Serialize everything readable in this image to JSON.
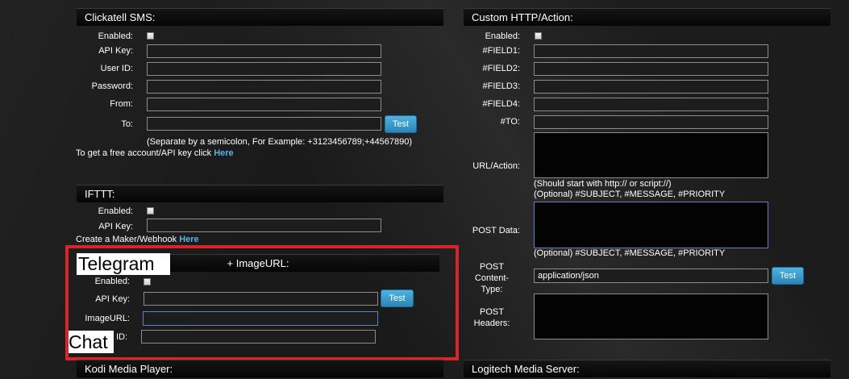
{
  "clickatell": {
    "title": "Clickatell SMS:",
    "enabled_label": "Enabled:",
    "api_key_label": "API Key:",
    "user_id_label": "User ID:",
    "password_label": "Password:",
    "from_label": "From:",
    "to_label": "To:",
    "test_label": "Test",
    "hint": "(Separate by a semicolon, For Example: +3123456789;+44567890)",
    "account_text": "To get a free account/API key click",
    "account_link": "Here"
  },
  "ifttt": {
    "title": "IFTTT:",
    "enabled_label": "Enabled:",
    "api_key_label": "API Key:",
    "maker_text": "Create a Maker/Webhook",
    "maker_link": "Here"
  },
  "telegram": {
    "title_suffix": "+ ImageURL:",
    "overlay_title": "Telegram",
    "enabled_label": "Enabled:",
    "api_key_label": "API Key:",
    "test_label": "Test",
    "image_url_label": "ImageURL:",
    "chat_id_label_suffix": "ID:",
    "overlay_chat": "Chat"
  },
  "kodi": {
    "title": "Kodi Media Player:"
  },
  "custom_http": {
    "title": "Custom HTTP/Action:",
    "enabled_label": "Enabled:",
    "field1_label": "#FIELD1:",
    "field2_label": "#FIELD2:",
    "field3_label": "#FIELD3:",
    "field4_label": "#FIELD4:",
    "to_label": "#TO:",
    "url_label": "URL/Action:",
    "url_hint1": "(Should start with http:// or script://)",
    "url_hint2": "(Optional) #SUBJECT, #MESSAGE, #PRIORITY",
    "post_data_label": "POST Data:",
    "post_data_hint": "(Optional) #SUBJECT, #MESSAGE, #PRIORITY",
    "content_type_label_1": "POST",
    "content_type_label_2": "Content-",
    "content_type_label_3": "Type:",
    "content_type_value": "application/json",
    "test_label": "Test",
    "headers_label_1": "POST",
    "headers_label_2": "Headers:"
  },
  "logitech": {
    "title": "Logitech Media Server:"
  },
  "colors": {
    "accent": "#2a85b6",
    "link": "#5ab3e6",
    "highlight": "#d7252a"
  }
}
